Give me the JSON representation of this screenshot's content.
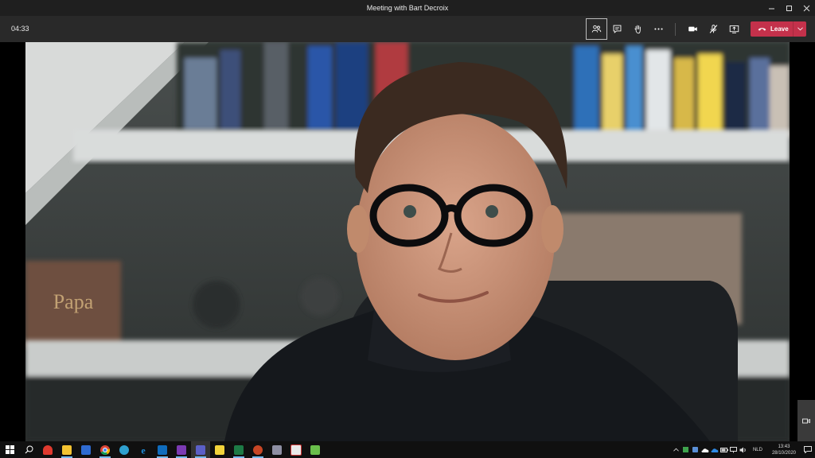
{
  "window": {
    "title": "Meeting with Bart Decroix",
    "controls": [
      "minimize-icon",
      "maximize-icon",
      "close-icon"
    ]
  },
  "meeting": {
    "timer": "04:33",
    "controls": [
      {
        "name": "show-participants-icon",
        "active": true
      },
      {
        "name": "chat-icon"
      },
      {
        "name": "raise-hand-icon"
      },
      {
        "name": "more-actions-icon"
      },
      {
        "name": "camera-icon"
      },
      {
        "name": "microphone-muted-icon"
      },
      {
        "name": "share-screen-icon"
      }
    ],
    "leave_label": "Leave",
    "leave_color": "#c4314b"
  },
  "video": {
    "picture_text": "Papa"
  },
  "taskbar": {
    "pinned": [
      "windows-start-icon",
      "search-icon",
      "security-app-icon",
      "file-explorer-icon",
      "network-app-icon",
      "chrome-icon",
      "edge-icon",
      "internet-explorer-icon",
      "outlook-icon",
      "onenote-icon",
      "teams-icon",
      "notes-app-icon",
      "excel-icon",
      "powerpoint-icon",
      "printer-app-icon",
      "photos-app-icon",
      "document-app-icon"
    ],
    "language": "NLD",
    "time": "13:43",
    "date": "28/10/2020"
  }
}
